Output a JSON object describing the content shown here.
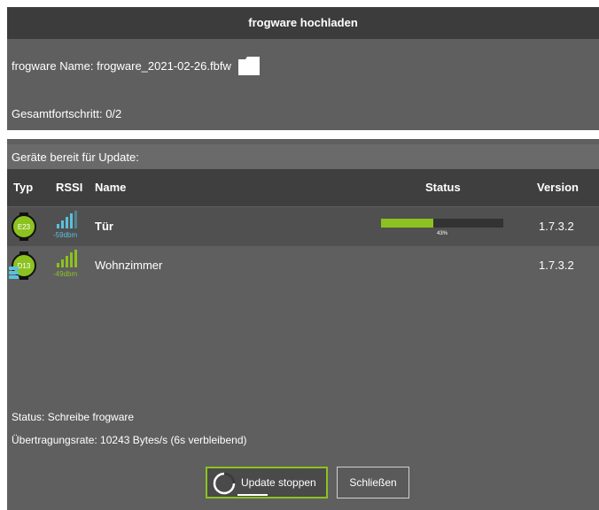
{
  "dialog": {
    "title": "frogware hochladen",
    "firmware_label": "frogware Name: frogware_2021-02-26.fbfw",
    "overall_progress_label": "Gesamtfortschritt: 0/2",
    "overall_progress_fraction": 0,
    "ready_label": "Geräte bereit für Update:"
  },
  "table": {
    "headers": {
      "type": "Typ",
      "rssi": "RSSI",
      "name": "Name",
      "status": "Status",
      "version": "Version"
    },
    "rows": [
      {
        "type_badge": "E23",
        "rssi": "-59dbm",
        "rssi_color": "#5bc0de",
        "name": "Tür",
        "progress_percent": 43,
        "progress_label": "43%",
        "version": "1.7.3.2",
        "has_battery": false
      },
      {
        "type_badge": "D13",
        "rssi": "-49dbm",
        "rssi_color": "#8cc21f",
        "name": "Wohnzimmer",
        "progress_percent": null,
        "progress_label": "",
        "version": "1.7.3.2",
        "has_battery": true
      }
    ]
  },
  "status": {
    "line1": "Status: Schreibe frogware",
    "line2": "Übertragungsrate: 10243 Bytes/s (6s verbleibend)"
  },
  "buttons": {
    "stop": "Update stoppen",
    "close": "Schließen"
  },
  "colors": {
    "accent": "#8cc21f",
    "background": "#5f5f5f",
    "titlebar": "#3c3c3c",
    "table_header": "#3f3f3f"
  },
  "icons": {
    "folder": "folder-icon",
    "device": "device-badge-icon",
    "battery": "battery-icon",
    "signal": "signal-strength-icon",
    "spinner": "loading-spinner-icon"
  }
}
